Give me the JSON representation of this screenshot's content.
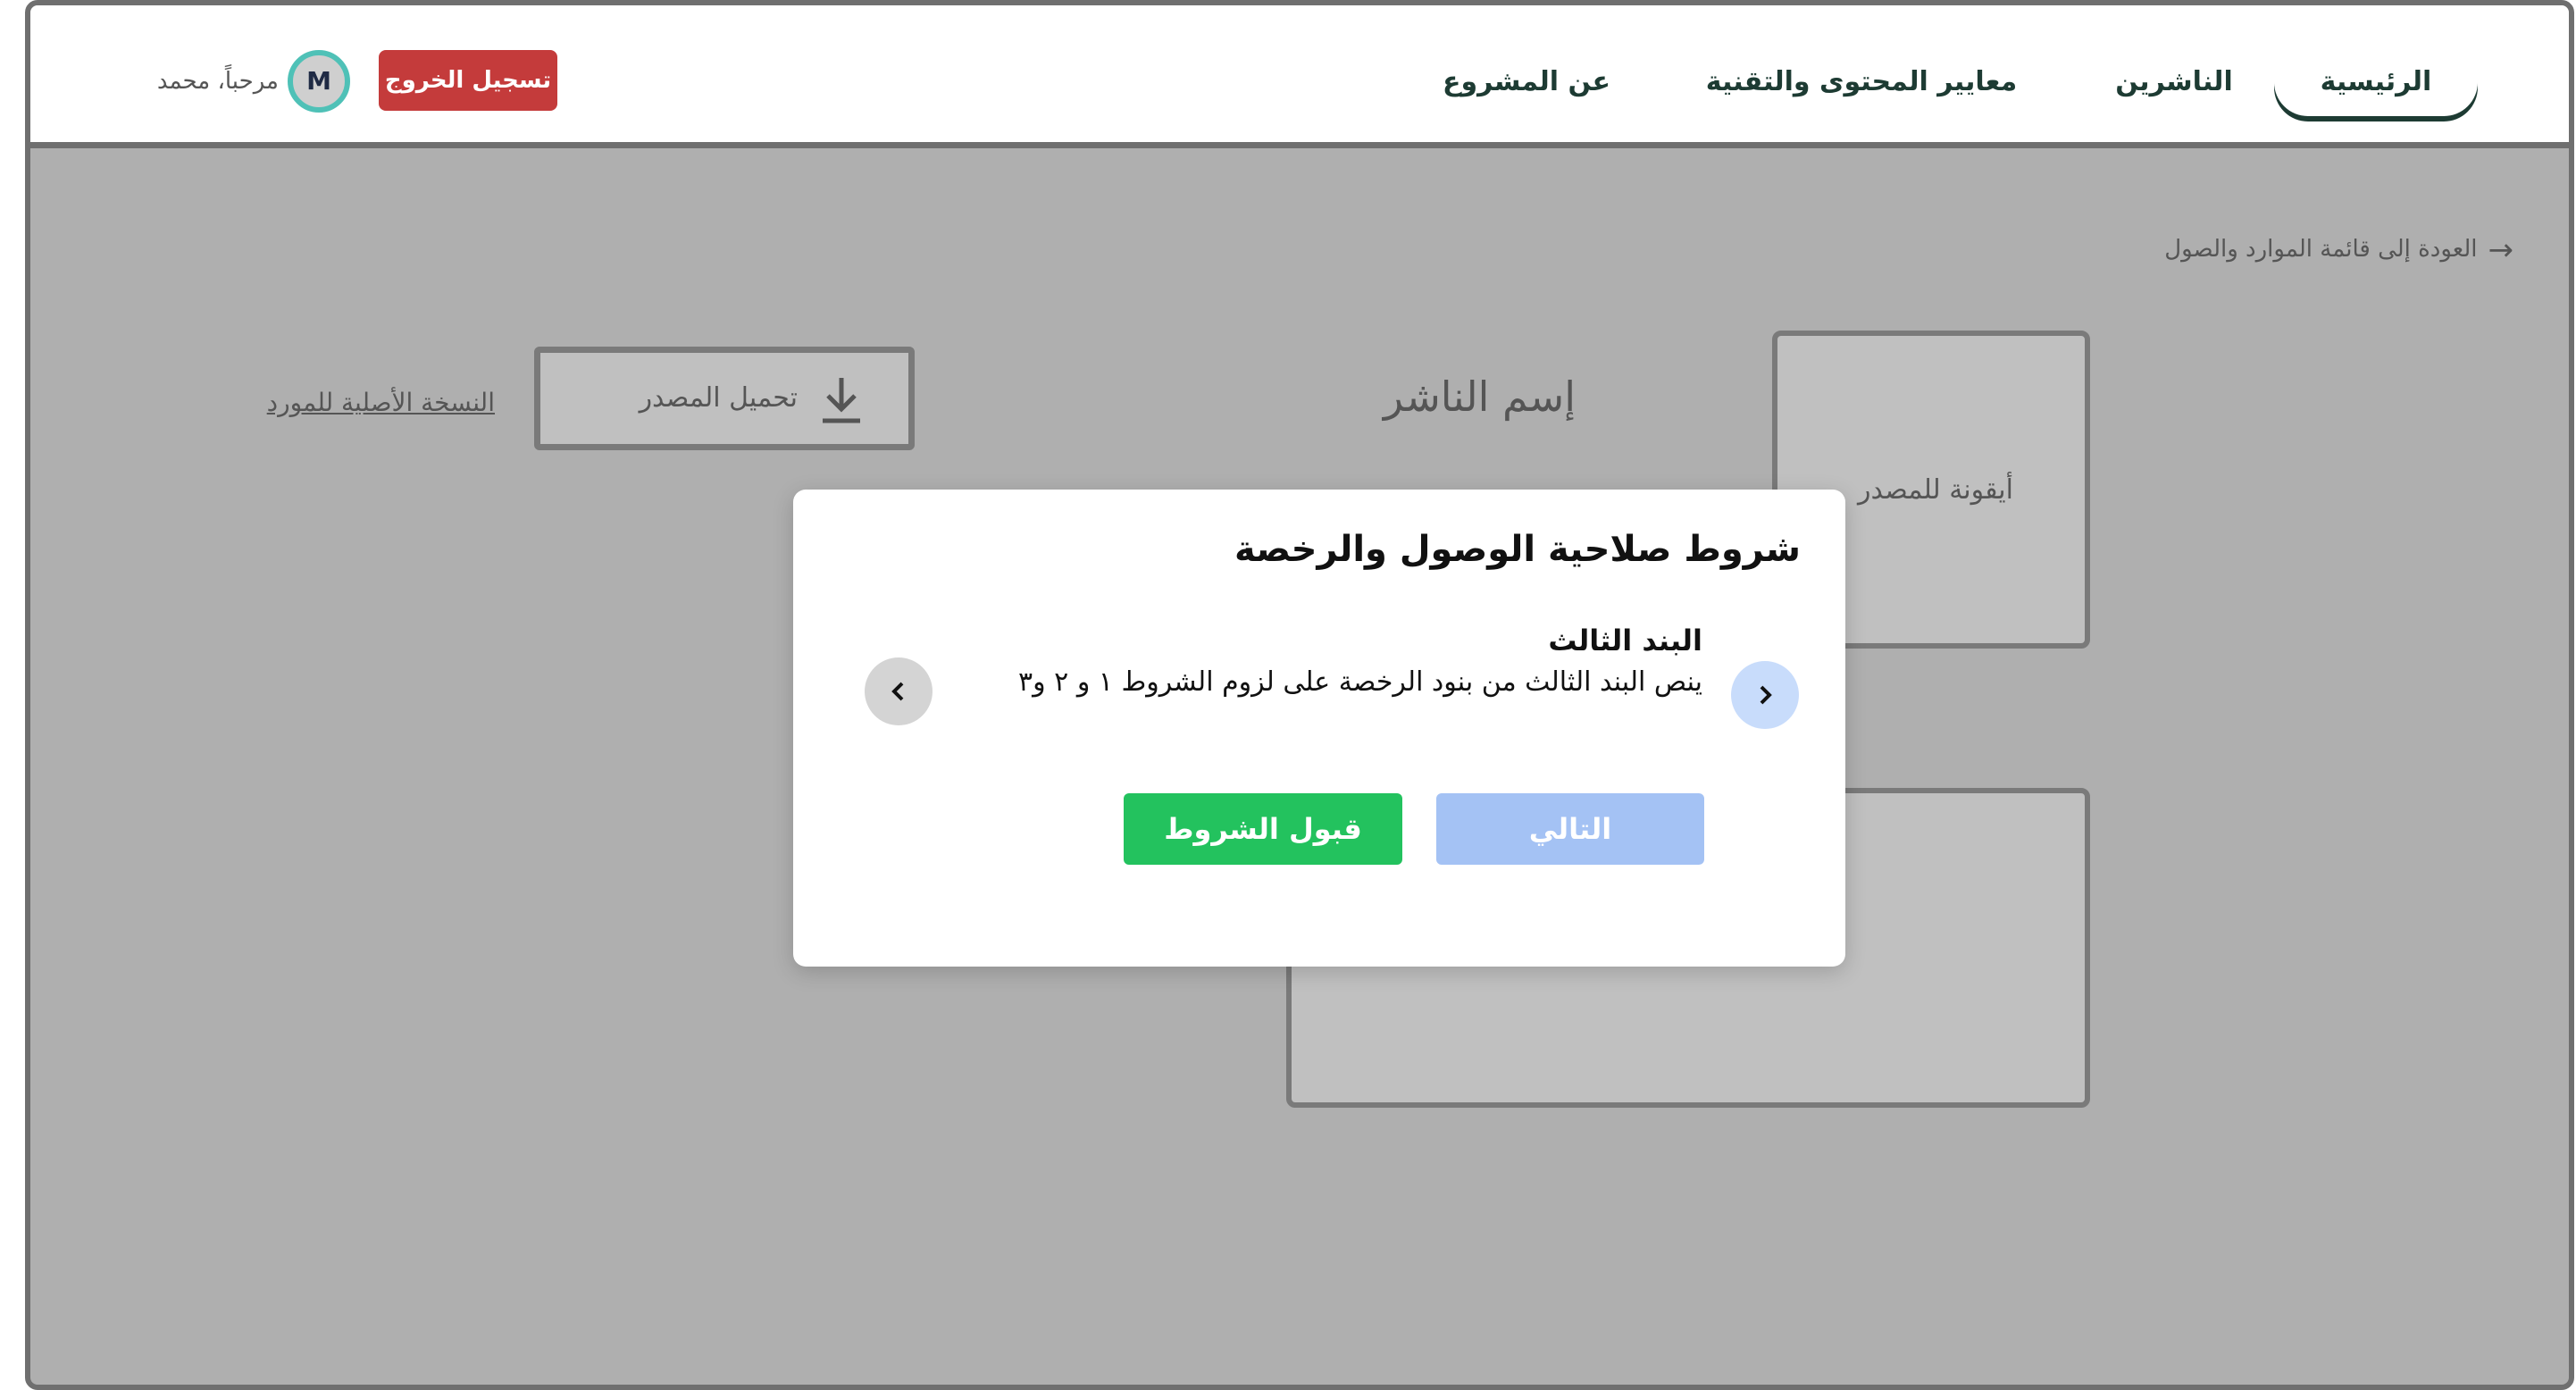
{
  "nav": {
    "home": "الرئيسية",
    "publishers": "الناشرين",
    "standards": "معايير المحتوى والتقنية",
    "about": "عن المشروع"
  },
  "user": {
    "logout": "تسجيل الخروج",
    "avatar_initial": "M",
    "greeting": "مرحباً، محمد"
  },
  "page": {
    "back_link": "العودة إلى قائمة الموارد والصول",
    "back_icon": "arrow-right-icon",
    "publisher_name": "إسم الناشر",
    "resource_icon_label": "أيقونة للمصدر",
    "download_label": "تحميل المصدر",
    "download_icon": "download-icon",
    "original_link": "النسخة الأصلية للمورد"
  },
  "modal": {
    "title": "شروط صلاحية الوصول والرخصة",
    "clause_heading": "البند الثالث",
    "clause_body": "ينص البند الثالث من بنود الرخصة على لزوم الشروط ١ و ٢ و٣",
    "next_label": "التالي",
    "accept_label": "قبول الشروط"
  },
  "colors": {
    "overlay": "#afafaf",
    "logout": "#c43b3b",
    "accept": "#23c25e",
    "next_disabled": "#a4c2f4",
    "avatar_ring": "#4fc1b7",
    "nav_text": "#1d3b33"
  }
}
